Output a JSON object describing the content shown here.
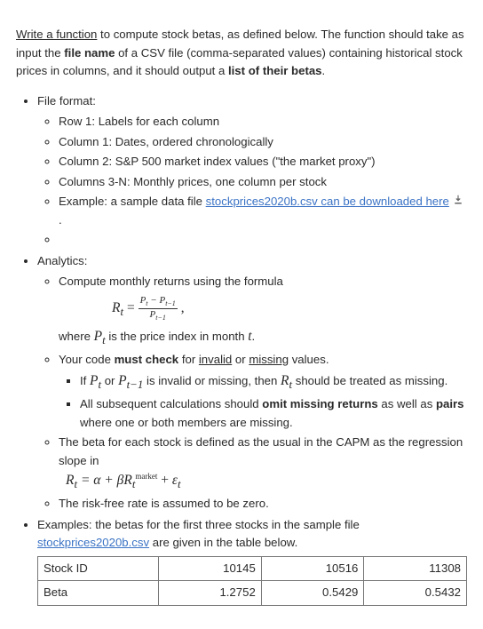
{
  "intro": {
    "lead_underline": "Write a function",
    "seg1": " to compute stock betas, as defined below. The function should take as input the ",
    "bold1": "file name",
    "seg2": " of a CSV file (comma-separated values) containing historical stock prices in columns, and it should output a ",
    "bold2": "list of their betas",
    "seg3": "."
  },
  "file_format": {
    "heading": "File format:",
    "row1": "Row 1: Labels for each column",
    "col1": "Column 1: Dates, ordered chronologically",
    "col2": "Column 2: S&P 500 market index values (\"the market proxy\")",
    "col3n": "Columns 3-N: Monthly prices, one column per stock",
    "example_pre": "Example:  a sample data file ",
    "example_link": "stockprices2020b.csv can be downloaded here",
    "example_post": " ."
  },
  "analytics": {
    "heading": "Analytics:",
    "returns_intro": "Compute monthly returns using the formula",
    "where_line_seg1": "where ",
    "where_line_seg2": " is the price index in month ",
    "where_line_seg3": ".",
    "check_seg1": "Your code ",
    "check_must": "must check",
    "check_seg2": " for ",
    "check_invalid": "invalid",
    "check_or": " or ",
    "check_missing": "missing",
    "check_seg3": " values.",
    "if_seg1": "If ",
    "if_seg2": " or ",
    "if_seg3": " is invalid or missing, then ",
    "if_seg4": " should be treated as missing.",
    "subseq_seg1": "All subsequent calculations should ",
    "omit_bold": "omit missing returns",
    "subseq_seg2": " as well as ",
    "pairs_bold": "pairs",
    "subseq_seg3": " where one or both members are missing.",
    "beta_def": "The beta for each stock is defined as the usual in the CAPM as the regression slope in",
    "riskfree": "The risk-free rate is assumed to be zero."
  },
  "examples": {
    "seg1": "Examples: the betas for the first three stocks in the sample file ",
    "link": "stockprices2020b.csv",
    "seg2": " are given in the table below."
  },
  "table": {
    "row1_label": "Stock ID",
    "row1_c1": "10145",
    "row1_c2": "10516",
    "row1_c3": "11308",
    "row2_label": "Beta",
    "row2_c1": "1.2752",
    "row2_c2": "0.5429",
    "row2_c3": "0.5432"
  },
  "chart_data": {
    "type": "table",
    "title": "Stock betas",
    "columns": [
      "Stock ID",
      "Beta"
    ],
    "rows": [
      [
        "10145",
        1.2752
      ],
      [
        "10516",
        0.5429
      ],
      [
        "11308",
        0.5432
      ]
    ]
  }
}
